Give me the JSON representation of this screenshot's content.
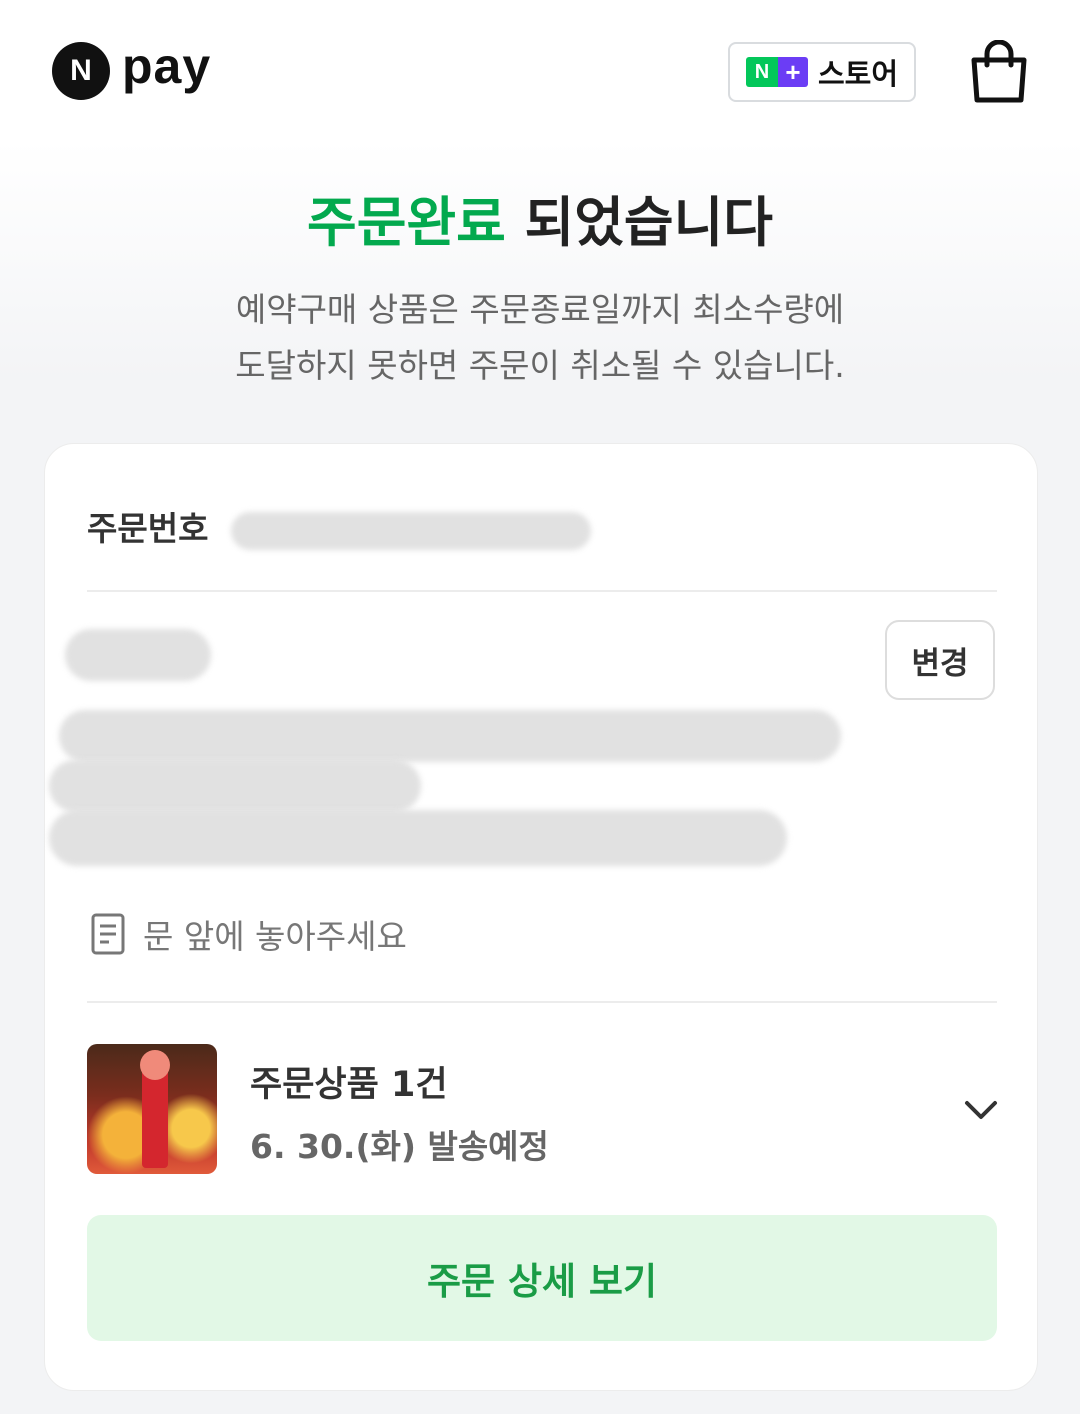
{
  "header": {
    "logo_letter": "N",
    "logo_text": "pay",
    "store_badge_n": "N",
    "store_badge_plus": "+",
    "store_label": "스토어",
    "cart_icon": "shopping-bag-icon"
  },
  "title": {
    "accent": "주문완료",
    "rest": " 되었습니다"
  },
  "subtitle": {
    "line1": "예약구매 상품은 주문종료일까지 최소수량에",
    "line2": "도달하지 못하면 주문이 취소될 수 있습니다."
  },
  "card": {
    "order_number_label": "주문번호",
    "change_button": "변경",
    "memo_icon": "document-icon",
    "memo_text": "문 앞에 놓아주세요",
    "product_title": "주문상품 1건",
    "product_shipping": "6. 30.(화) 발송예정",
    "expand_icon": "chevron-down-icon",
    "detail_button": "주문 상세 보기"
  },
  "colors": {
    "accent_green": "#03a94e",
    "button_bg": "#e2f8e6",
    "button_text": "#1a9c46"
  }
}
